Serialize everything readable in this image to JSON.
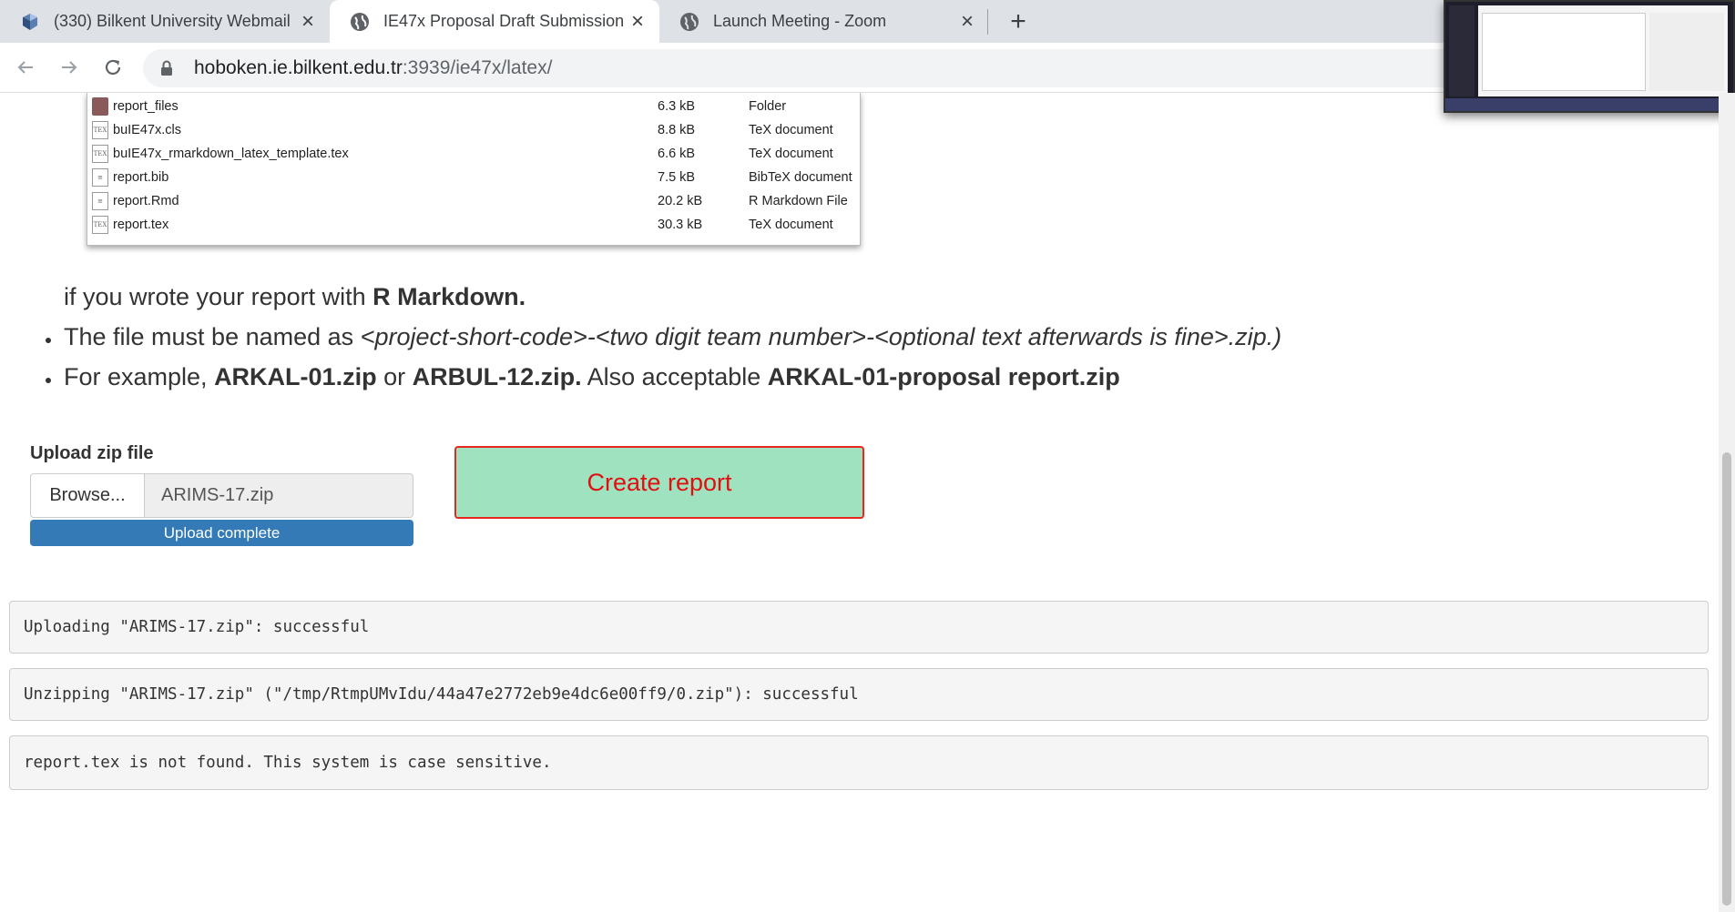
{
  "browser": {
    "tabs": [
      {
        "label": "(330) Bilkent University Webmail",
        "active": false,
        "icon": "bilkent-icon"
      },
      {
        "label": "IE47x Proposal Draft Submission",
        "active": true,
        "icon": "globe-icon"
      },
      {
        "label": "Launch Meeting - Zoom",
        "active": false,
        "icon": "globe-icon"
      }
    ],
    "url_host": "hoboken.ie.bilkent.edu.tr",
    "url_path": ":3939/ie47x/latex/"
  },
  "files": [
    {
      "name": "report_files",
      "size": "6.3 kB",
      "type": "Folder",
      "icon": "folder-icon"
    },
    {
      "name": "buIE47x.cls",
      "size": "8.8 kB",
      "type": "TeX document",
      "icon": "tex-icon"
    },
    {
      "name": "buIE47x_rmarkdown_latex_template.tex",
      "size": "6.6 kB",
      "type": "TeX document",
      "icon": "tex-icon"
    },
    {
      "name": "report.bib",
      "size": "7.5 kB",
      "type": "BibTeX document",
      "icon": "text-file-icon"
    },
    {
      "name": "report.Rmd",
      "size": "20.2 kB",
      "type": "R Markdown File",
      "icon": "text-file-icon"
    },
    {
      "name": "report.tex",
      "size": "30.3 kB",
      "type": "TeX document",
      "icon": "tex-icon"
    }
  ],
  "instructions": {
    "line1_pre": "if you wrote your report with ",
    "line1_bold": "R Markdown.",
    "line2_pre": "The file must be named as ",
    "line2_italic": "<project-short-code>-<two digit team number>-<optional text afterwards is fine>.zip.)",
    "line3_pre": "For example, ",
    "line3_bold1": "ARKAL-01.zip",
    "line3_mid": " or ",
    "line3_bold2": "ARBUL-12.zip.",
    "line3_mid2": " Also acceptable ",
    "line3_bold3": "ARKAL-01-proposal report.zip"
  },
  "upload": {
    "label": "Upload zip file",
    "browse_label": "Browse...",
    "file_name": "ARIMS-17.zip",
    "progress_text": "Upload complete",
    "progress": 1.0
  },
  "create_button": "Create report",
  "log": [
    "Uploading \"ARIMS-17.zip\": successful",
    "Unzipping \"ARIMS-17.zip\" (\"/tmp/RtmpUMvIdu/44a47e2772eb9e4dc6e00ff9/0.zip\"): successful",
    "report.tex is not found. This system is case sensitive."
  ],
  "colors": {
    "create_bg": "#9fe2bf",
    "create_border": "#e8261e",
    "create_text": "#e01010",
    "progress_bg": "#337ab7"
  }
}
